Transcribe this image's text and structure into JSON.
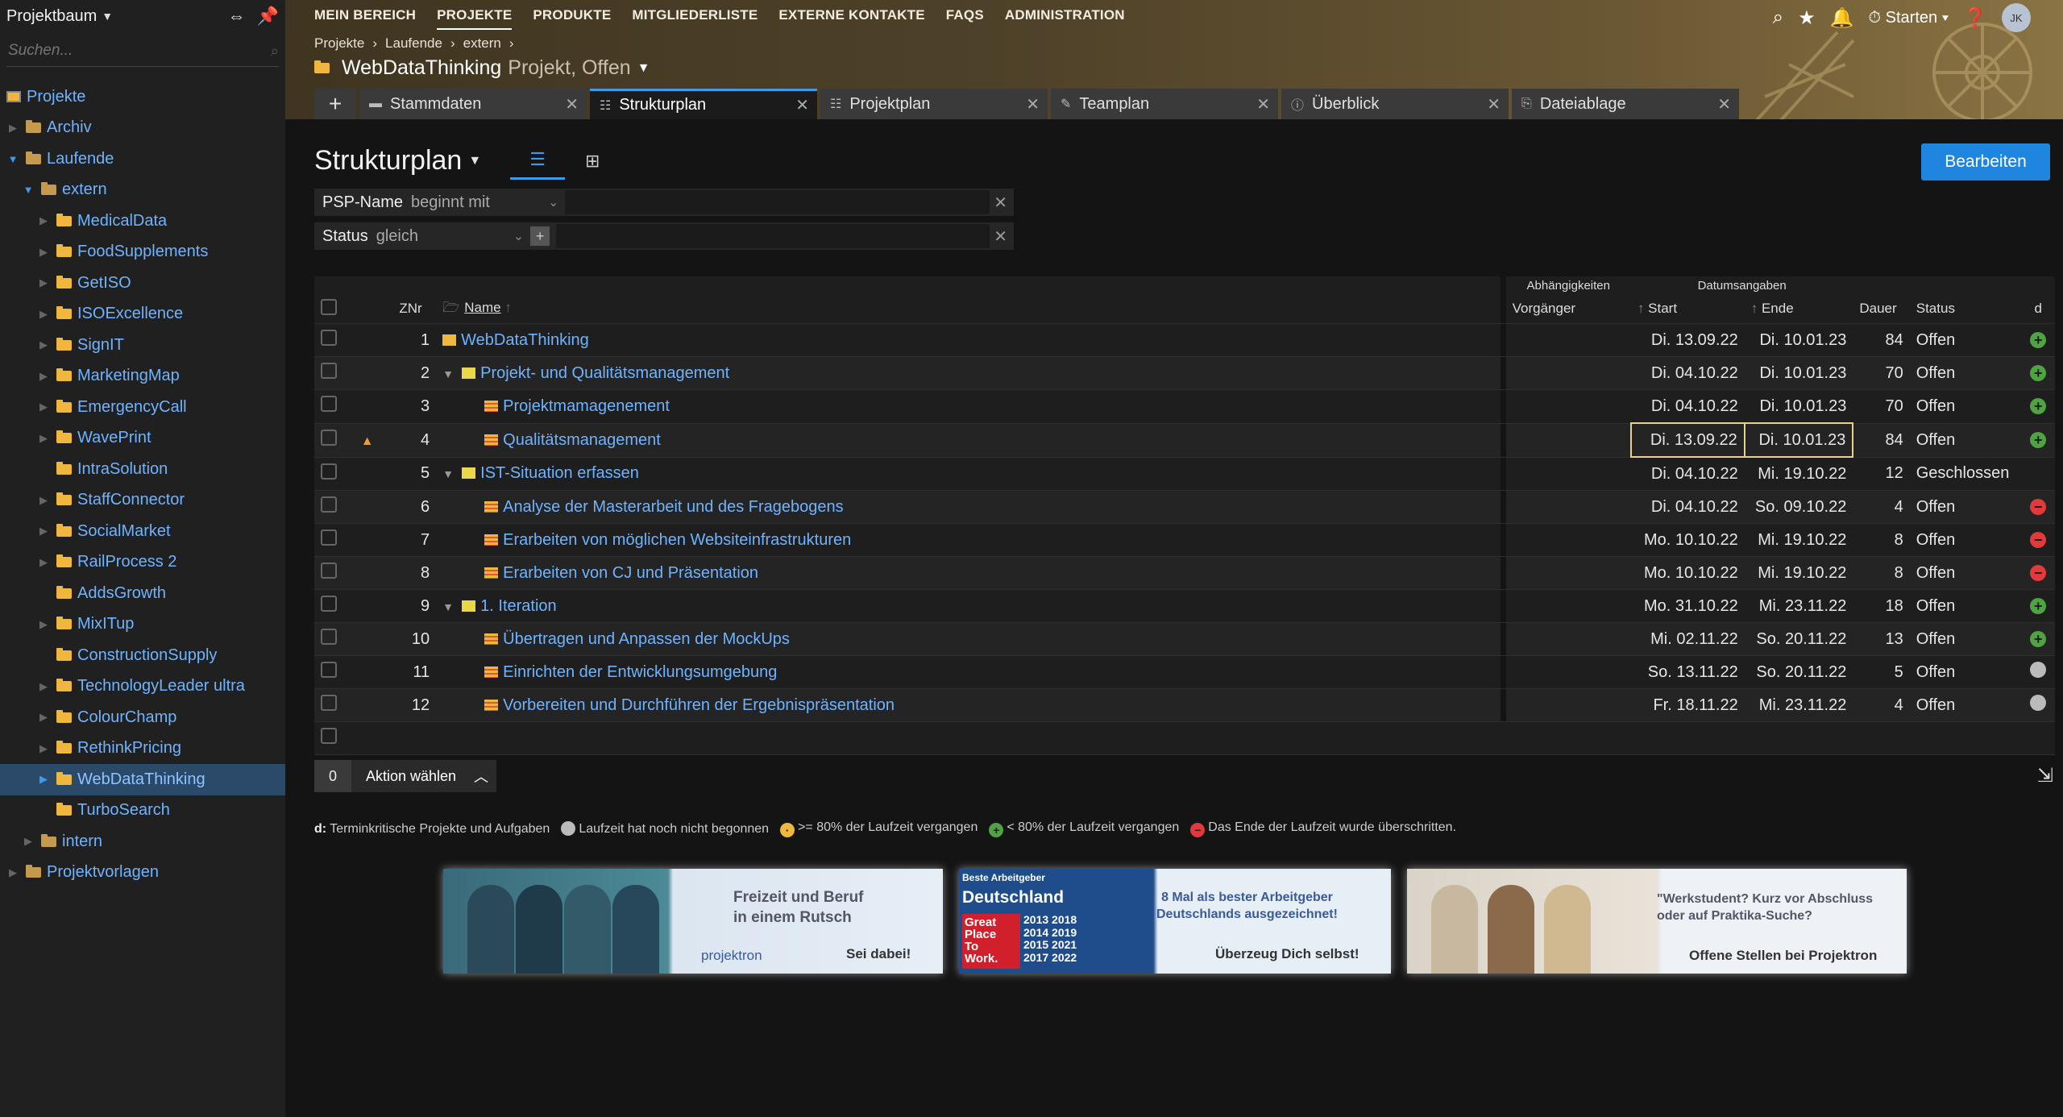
{
  "sidebar": {
    "title": "Projektbaum",
    "search_placeholder": "Suchen...",
    "root": "Projekte",
    "items": [
      {
        "label": "Archiv",
        "level": 1,
        "expanded": false
      },
      {
        "label": "Laufende",
        "level": 1,
        "expanded": true
      },
      {
        "label": "extern",
        "level": 2,
        "expanded": true
      },
      {
        "label": "MedicalData",
        "level": 3
      },
      {
        "label": "FoodSupplements",
        "level": 3
      },
      {
        "label": "GetISO",
        "level": 3
      },
      {
        "label": "ISOExcellence",
        "level": 3
      },
      {
        "label": "SignIT",
        "level": 3
      },
      {
        "label": "MarketingMap",
        "level": 3
      },
      {
        "label": "EmergencyCall",
        "level": 3
      },
      {
        "label": "WavePrint",
        "level": 3
      },
      {
        "label": "IntraSolution",
        "level": 3,
        "leaf": true
      },
      {
        "label": "StaffConnector",
        "level": 3
      },
      {
        "label": "SocialMarket",
        "level": 3
      },
      {
        "label": "RailProcess 2",
        "level": 3
      },
      {
        "label": "AddsGrowth",
        "level": 3,
        "leaf": true
      },
      {
        "label": "MixITup",
        "level": 3
      },
      {
        "label": "ConstructionSupply",
        "level": 3,
        "leaf": true
      },
      {
        "label": "TechnologyLeader ultra",
        "level": 3
      },
      {
        "label": "ColourChamp",
        "level": 3
      },
      {
        "label": "RethinkPricing",
        "level": 3
      },
      {
        "label": "WebDataThinking",
        "level": 3,
        "selected": true
      },
      {
        "label": "TurboSearch",
        "level": 3,
        "leaf": true
      },
      {
        "label": "intern",
        "level": 2
      },
      {
        "label": "Projektvorlagen",
        "level": 1
      }
    ]
  },
  "topnav": {
    "items": [
      "MEIN BEREICH",
      "PROJEKTE",
      "PRODUKTE",
      "MITGLIEDERLISTE",
      "EXTERNE KONTAKTE",
      "FAQS",
      "ADMINISTRATION"
    ],
    "active": "PROJEKTE"
  },
  "breadcrumb": [
    "Projekte",
    "›",
    "Laufende",
    "›",
    "extern",
    "›"
  ],
  "project": {
    "name": "WebDataThinking",
    "subtitle": "Projekt, Offen"
  },
  "user": {
    "start_label": "Starten",
    "initials": "JK"
  },
  "tabs": [
    "Stammdaten",
    "Strukturplan",
    "Projektplan",
    "Teamplan",
    "Überblick",
    "Dateiablage"
  ],
  "active_tab": "Strukturplan",
  "view": {
    "title": "Strukturplan",
    "edit_label": "Bearbeiten"
  },
  "filters": [
    {
      "label": "PSP-Name",
      "op": "beginnt mit",
      "value": ""
    },
    {
      "label": "Status",
      "op": "gleich",
      "value": ""
    }
  ],
  "table": {
    "group_headers": {
      "deps": "Abhängigkeiten",
      "dates": "Datumsangaben"
    },
    "headers": {
      "znr": "ZNr",
      "name": "Name",
      "pred": "Vorgänger",
      "start": "Start",
      "end": "Ende",
      "dur": "Dauer",
      "status": "Status",
      "d": "d"
    },
    "rows": [
      {
        "znr": "1",
        "name": "WebDataThinking",
        "type": "project",
        "indent": 0,
        "start": "Di. 13.09.22",
        "end": "Di. 10.01.23",
        "dur": "84",
        "status": "Offen",
        "d": "green"
      },
      {
        "znr": "2",
        "name": "Projekt- und Qualitätsmanagement",
        "type": "summary",
        "indent": 0,
        "start": "Di. 04.10.22",
        "end": "Di. 10.01.23",
        "dur": "70",
        "status": "Offen",
        "d": "green"
      },
      {
        "znr": "3",
        "name": "Projektmamagenement",
        "type": "task",
        "indent": 1,
        "start": "Di. 04.10.22",
        "end": "Di. 10.01.23",
        "dur": "70",
        "status": "Offen",
        "d": "green"
      },
      {
        "znr": "4",
        "name": "Qualitätsmanagement",
        "type": "task",
        "indent": 1,
        "start": "Di. 13.09.22",
        "end": "Di. 10.01.23",
        "dur": "84",
        "status": "Offen",
        "d": "green",
        "warn": true,
        "highlight": true
      },
      {
        "znr": "5",
        "name": "IST-Situation erfassen",
        "type": "summary",
        "indent": 0,
        "start": "Di. 04.10.22",
        "end": "Mi. 19.10.22",
        "dur": "12",
        "status": "Geschlossen",
        "d": ""
      },
      {
        "znr": "6",
        "name": "Analyse der Masterarbeit und des Fragebogens",
        "type": "task",
        "indent": 1,
        "start": "Di. 04.10.22",
        "end": "So. 09.10.22",
        "dur": "4",
        "status": "Offen",
        "d": "red"
      },
      {
        "znr": "7",
        "name": "Erarbeiten von möglichen Websiteinfrastrukturen",
        "type": "task",
        "indent": 1,
        "start": "Mo. 10.10.22",
        "end": "Mi. 19.10.22",
        "dur": "8",
        "status": "Offen",
        "d": "red"
      },
      {
        "znr": "8",
        "name": "Erarbeiten von CJ und Präsentation",
        "type": "task",
        "indent": 1,
        "start": "Mo. 10.10.22",
        "end": "Mi. 19.10.22",
        "dur": "8",
        "status": "Offen",
        "d": "red"
      },
      {
        "znr": "9",
        "name": "1. Iteration",
        "type": "summary",
        "indent": 0,
        "start": "Mo. 31.10.22",
        "end": "Mi. 23.11.22",
        "dur": "18",
        "status": "Offen",
        "d": "green"
      },
      {
        "znr": "10",
        "name": "Übertragen und Anpassen der MockUps",
        "type": "task",
        "indent": 1,
        "start": "Mi. 02.11.22",
        "end": "So. 20.11.22",
        "dur": "13",
        "status": "Offen",
        "d": "green"
      },
      {
        "znr": "11",
        "name": "Einrichten der Entwicklungsumgebung",
        "type": "task",
        "indent": 1,
        "start": "So. 13.11.22",
        "end": "So. 20.11.22",
        "dur": "5",
        "status": "Offen",
        "d": "grey"
      },
      {
        "znr": "12",
        "name": "Vorbereiten und Durchführen der Ergebnispräsentation",
        "type": "task",
        "indent": 1,
        "start": "Fr. 18.11.22",
        "end": "Mi. 23.11.22",
        "dur": "4",
        "status": "Offen",
        "d": "grey"
      }
    ]
  },
  "actionbar": {
    "count": "0",
    "label": "Aktion wählen"
  },
  "legend": {
    "title": "d:",
    "intro": "Terminkritische Projekte und Aufgaben",
    "grey": "Laufzeit hat noch nicht begonnen",
    "yellow": ">= 80% der Laufzeit vergangen",
    "green": "< 80% der Laufzeit vergangen",
    "red": "Das Ende der Laufzeit wurde überschritten."
  },
  "banners": [
    {
      "headline": "Freizeit und Beruf\nin einem Rutsch",
      "brand": "projektron",
      "cta": "Sei dabei!"
    },
    {
      "badge_top": "Beste Arbeitgeber",
      "badge_title": "Deutschland",
      "gp": "Great\nPlace\nTo\nWork.",
      "years": "2013 2018\n2014 2019\n2015 2021\n2017 2022",
      "headline": "8 Mal als bester Arbeitgeber\nDeutschlands ausgezeichnet!",
      "cta": "Überzeug Dich selbst!"
    },
    {
      "headline": "\"Werkstudent? Kurz vor Abschluss\noder auf Praktika-Suche?",
      "cta": "Offene Stellen bei Projektron"
    }
  ],
  "colors": {
    "accent": "#1f86e0",
    "link": "#6fb3ff",
    "green": "#4fa342",
    "red": "#e23a3a",
    "highlight": "#e8d28a"
  }
}
